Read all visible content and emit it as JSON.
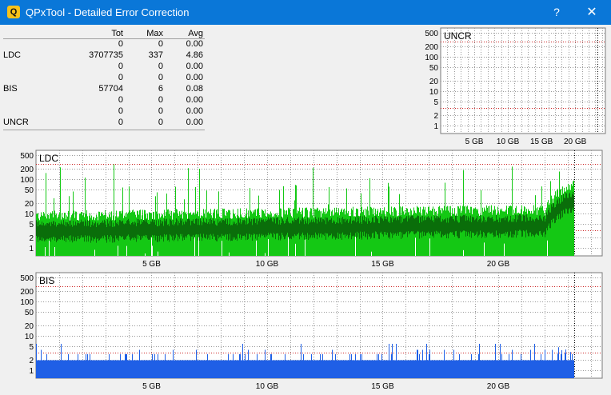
{
  "window": {
    "app_icon": "Q",
    "title": "QPxTool - Detailed Error Correction",
    "help_label": "?",
    "close_label": "✕"
  },
  "stats": {
    "headers": [
      "",
      "Tot",
      "Max",
      "Avg"
    ],
    "rows": [
      {
        "label": "",
        "tot": "0",
        "max": "0",
        "avg": "0.00"
      },
      {
        "label": "LDC",
        "tot": "3707735",
        "max": "337",
        "avg": "4.86"
      },
      {
        "label": "",
        "tot": "0",
        "max": "0",
        "avg": "0.00"
      },
      {
        "label": "",
        "tot": "0",
        "max": "0",
        "avg": "0.00"
      },
      {
        "label": "BIS",
        "tot": "57704",
        "max": "6",
        "avg": "0.08"
      },
      {
        "label": "",
        "tot": "0",
        "max": "0",
        "avg": "0.00"
      },
      {
        "label": "",
        "tot": "0",
        "max": "0",
        "avg": "0.00"
      },
      {
        "label": "UNCR",
        "tot": "0",
        "max": "0",
        "avg": "0.00"
      }
    ]
  },
  "colors": {
    "titlebar": "#0a77d8",
    "ldc_light": "#14c814",
    "ldc_dark": "#0a6e0a",
    "bis": "#1f5fe6",
    "threshold": "#cc2222",
    "grid": "#9a9a9a"
  },
  "chart_data": [
    {
      "type": "area",
      "title": "UNCR",
      "y_scale": "log",
      "y_ticks": [
        1,
        2,
        5,
        10,
        20,
        50,
        100,
        200,
        500
      ],
      "y_tick_labels": [
        "1",
        "2",
        "5",
        "10",
        "20",
        "50",
        "100",
        "200",
        "500"
      ],
      "x_ticks": [
        5,
        10,
        15,
        20
      ],
      "x_tick_labels": [
        "5 GB",
        "10 GB",
        "15 GB",
        "20 GB"
      ],
      "xlim": [
        0,
        24.5
      ],
      "end_marker_gb": 23.3,
      "threshold": 280,
      "series": [
        {
          "values": [
            0
          ]
        }
      ]
    },
    {
      "type": "area",
      "title": "LDC",
      "y_scale": "log",
      "y_ticks": [
        1,
        2,
        5,
        10,
        20,
        50,
        100,
        200,
        500
      ],
      "y_tick_labels": [
        "1",
        "2",
        "5",
        "10",
        "20",
        "50",
        "100",
        "200",
        "500"
      ],
      "x_ticks": [
        5,
        10,
        15,
        20
      ],
      "x_tick_labels": [
        "5 GB",
        "10 GB",
        "15 GB",
        "20 GB"
      ],
      "xlim": [
        0,
        24.5
      ],
      "end_marker_gb": 23.3,
      "threshold": 280,
      "max": 337,
      "avg": 4.86
    },
    {
      "type": "bar",
      "title": "BIS",
      "y_scale": "log",
      "y_ticks": [
        1,
        2,
        5,
        10,
        20,
        50,
        100,
        200,
        500
      ],
      "y_tick_labels": [
        "1",
        "2",
        "5",
        "10",
        "20",
        "50",
        "100",
        "200",
        "500"
      ],
      "x_ticks": [
        5,
        10,
        15,
        20
      ],
      "x_tick_labels": [
        "5 GB",
        "10 GB",
        "15 GB",
        "20 GB"
      ],
      "xlim": [
        0,
        24.5
      ],
      "end_marker_gb": 23.3,
      "threshold": 280,
      "max": 6,
      "avg": 0.08
    }
  ]
}
